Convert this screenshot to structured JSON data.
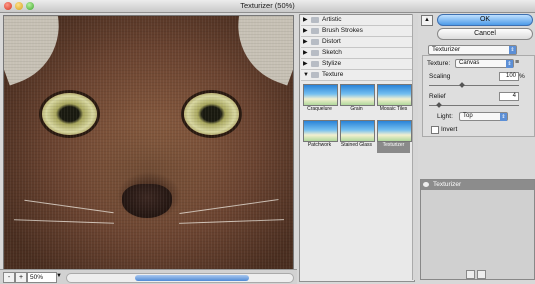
{
  "window": {
    "title": "Texturizer (50%)"
  },
  "statusbar": {
    "zoom_minus": "-",
    "zoom_plus": "+",
    "zoom": "50%"
  },
  "gallery": {
    "categories": [
      {
        "label": "Artistic",
        "expanded": false
      },
      {
        "label": "Brush Strokes",
        "expanded": false
      },
      {
        "label": "Distort",
        "expanded": false
      },
      {
        "label": "Sketch",
        "expanded": false
      },
      {
        "label": "Stylize",
        "expanded": false
      },
      {
        "label": "Texture",
        "expanded": true
      }
    ],
    "thumbnails": [
      {
        "label": "Craquelure"
      },
      {
        "label": "Grain"
      },
      {
        "label": "Mosaic Tiles"
      },
      {
        "label": "Patchwork"
      },
      {
        "label": "Stained Glass"
      },
      {
        "label": "Texturizer",
        "selected": true
      }
    ]
  },
  "panel": {
    "ok": "OK",
    "cancel": "Cancel",
    "filter_select": "Texturizer",
    "texture_label": "Texture:",
    "texture_value": "Canvas",
    "scaling_label": "Scaling",
    "scaling_value": "100",
    "scaling_unit": "%",
    "relief_label": "Relief",
    "relief_value": "4",
    "light_label": "Light:",
    "light_value": "Top",
    "invert_label": "Invert",
    "invert_checked": false
  },
  "layers": {
    "items": [
      {
        "label": "Texturizer"
      }
    ]
  },
  "colors": {
    "accent": "#4d9be8",
    "selected_thumb": "#8a8a8a"
  }
}
